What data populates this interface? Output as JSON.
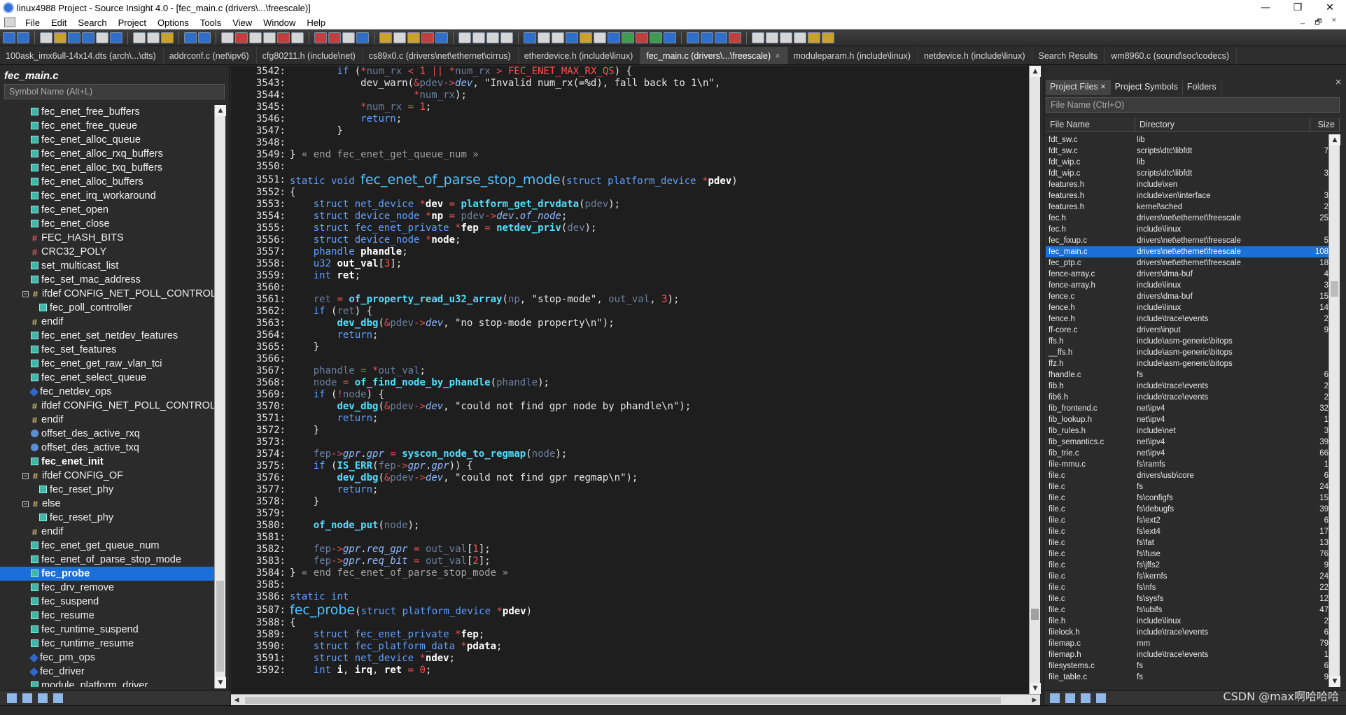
{
  "window": {
    "title": "linux4988 Project - Source Insight 4.0 - [fec_main.c (drivers\\...\\freescale)]",
    "controls": [
      "—",
      "❐",
      "✕"
    ]
  },
  "menu": {
    "items": [
      "File",
      "Edit",
      "Search",
      "Project",
      "Options",
      "Tools",
      "View",
      "Window",
      "Help"
    ],
    "right_controls": [
      "_",
      "🗗",
      "×"
    ]
  },
  "tabs": [
    {
      "label": "100ask_imx6ull-14x14.dts (arch\\...\\dts)",
      "active": false
    },
    {
      "label": "addrconf.c (net\\ipv6)",
      "active": false
    },
    {
      "label": "cfg80211.h (include\\net)",
      "active": false
    },
    {
      "label": "cs89x0.c (drivers\\net\\ethernet\\cirrus)",
      "active": false
    },
    {
      "label": "etherdevice.h (include\\linux)",
      "active": false
    },
    {
      "label": "fec_main.c (drivers\\...\\freescale)",
      "active": true,
      "close": "×"
    },
    {
      "label": "moduleparam.h (include\\linux)",
      "active": false
    },
    {
      "label": "netdevice.h (include\\linux)",
      "active": false
    },
    {
      "label": "Search Results",
      "active": false
    },
    {
      "label": "wm8960.c (sound\\soc\\codecs)",
      "active": false
    }
  ],
  "symbol_panel": {
    "title": "fec_main.c",
    "search_placeholder": "Symbol Name (Alt+L)",
    "symbols": [
      {
        "label": "fec_enet_free_buffers",
        "icon": "func",
        "indent": 1
      },
      {
        "label": "fec_enet_free_queue",
        "icon": "func",
        "indent": 1
      },
      {
        "label": "fec_enet_alloc_queue",
        "icon": "func",
        "indent": 1
      },
      {
        "label": "fec_enet_alloc_rxq_buffers",
        "icon": "func",
        "indent": 1
      },
      {
        "label": "fec_enet_alloc_txq_buffers",
        "icon": "func",
        "indent": 1
      },
      {
        "label": "fec_enet_alloc_buffers",
        "icon": "func",
        "indent": 1
      },
      {
        "label": "fec_enet_irq_workaround",
        "icon": "func",
        "indent": 1
      },
      {
        "label": "fec_enet_open",
        "icon": "func",
        "indent": 1
      },
      {
        "label": "fec_enet_close",
        "icon": "func",
        "indent": 1
      },
      {
        "label": "FEC_HASH_BITS",
        "icon": "def",
        "indent": 1
      },
      {
        "label": "CRC32_POLY",
        "icon": "def",
        "indent": 1
      },
      {
        "label": "set_multicast_list",
        "icon": "func",
        "indent": 1
      },
      {
        "label": "fec_set_mac_address",
        "icon": "func",
        "indent": 1
      },
      {
        "label": "ifdef CONFIG_NET_POLL_CONTROLL",
        "icon": "if",
        "indent": 0,
        "tree": "−"
      },
      {
        "label": "fec_poll_controller",
        "icon": "func",
        "indent": 2
      },
      {
        "label": "endif",
        "icon": "if",
        "indent": 1
      },
      {
        "label": "fec_enet_set_netdev_features",
        "icon": "func",
        "indent": 1
      },
      {
        "label": "fec_set_features",
        "icon": "func",
        "indent": 1
      },
      {
        "label": "fec_enet_get_raw_vlan_tci",
        "icon": "func",
        "indent": 1
      },
      {
        "label": "fec_enet_select_queue",
        "icon": "func",
        "indent": 1
      },
      {
        "label": "fec_netdev_ops",
        "icon": "struct",
        "indent": 1
      },
      {
        "label": "ifdef CONFIG_NET_POLL_CONTROLL",
        "icon": "if",
        "indent": 1
      },
      {
        "label": "endif",
        "icon": "if",
        "indent": 1
      },
      {
        "label": "offset_des_active_rxq",
        "icon": "var",
        "indent": 1
      },
      {
        "label": "offset_des_active_txq",
        "icon": "var",
        "indent": 1
      },
      {
        "label": "fec_enet_init",
        "icon": "func",
        "indent": 1,
        "bold": true
      },
      {
        "label": "ifdef CONFIG_OF",
        "icon": "if",
        "indent": 0,
        "tree": "−"
      },
      {
        "label": "fec_reset_phy",
        "icon": "func",
        "indent": 2
      },
      {
        "label": "else",
        "icon": "if",
        "indent": 0,
        "tree": "−"
      },
      {
        "label": "fec_reset_phy",
        "icon": "func",
        "indent": 2
      },
      {
        "label": "endif",
        "icon": "if",
        "indent": 1
      },
      {
        "label": "fec_enet_get_queue_num",
        "icon": "func",
        "indent": 1
      },
      {
        "label": "fec_enet_of_parse_stop_mode",
        "icon": "func",
        "indent": 1
      },
      {
        "label": "fec_probe",
        "icon": "func",
        "indent": 1,
        "selected": true
      },
      {
        "label": "fec_drv_remove",
        "icon": "func",
        "indent": 1
      },
      {
        "label": "fec_suspend",
        "icon": "func",
        "indent": 1
      },
      {
        "label": "fec_resume",
        "icon": "func",
        "indent": 1
      },
      {
        "label": "fec_runtime_suspend",
        "icon": "func",
        "indent": 1
      },
      {
        "label": "fec_runtime_resume",
        "icon": "func",
        "indent": 1
      },
      {
        "label": "fec_pm_ops",
        "icon": "struct",
        "indent": 1
      },
      {
        "label": "fec_driver",
        "icon": "struct",
        "indent": 1
      },
      {
        "label": "module_platform_driver",
        "icon": "func",
        "indent": 1
      }
    ]
  },
  "code_lines": [
    {
      "n": "3542:",
      "h": "        <span class=\"kw\">if</span> (<span class=\"op\">*</span><span class=\"par\">num_rx</span> <span class=\"op\">&lt;</span> <span class=\"num2\">1</span> <span class=\"op\">||</span> <span class=\"op\">*</span><span class=\"par\">num_rx</span> <span class=\"op\">&gt;</span> <span class=\"mac\">FEC_ENET_MAX_RX_QS</span>) {"
    },
    {
      "n": "3543:",
      "h": "            dev_warn(<span class=\"op\">&amp;</span><span class=\"par\">pdev</span><span class=\"op\">-&gt;</span><span class=\"it\">dev</span>, \"Invalid num_rx(=%d), fall back to 1\\n\","
    },
    {
      "n": "3544:",
      "h": "                     <span class=\"op\">*</span><span class=\"par\">num_rx</span>);"
    },
    {
      "n": "3545:",
      "h": "            <span class=\"op\">*</span><span class=\"par\">num_rx</span> <span class=\"op\">=</span> <span class=\"num2\">1</span>;"
    },
    {
      "n": "3546:",
      "h": "            <span class=\"kw\">return</span>;"
    },
    {
      "n": "3547:",
      "h": "        }"
    },
    {
      "n": "3548:",
      "h": ""
    },
    {
      "n": "3549:",
      "h": "<span class=\"brk\">}</span> <span class=\"cm\">« end fec_enet_get_queue_num »</span>"
    },
    {
      "n": "3550:",
      "h": ""
    },
    {
      "n": "3551:",
      "big": true,
      "h": "<span class=\"kw\">static</span> <span class=\"kw\">void</span> <span class=\"fnbig\">fec_enet_of_parse_stop_mode</span>(<span class=\"ty\">struct</span> <span class=\"ty\">platform_device</span> <span class=\"op\">*</span><span class=\"bold\">pdev</span>)"
    },
    {
      "n": "3552:",
      "h": "{"
    },
    {
      "n": "3553:",
      "h": "    <span class=\"ty\">struct net_device</span> <span class=\"op\">*</span><span class=\"bold\">dev</span> <span class=\"op\">=</span> <span class=\"fn\">platform_get_drvdata</span>(<span class=\"par\">pdev</span>);"
    },
    {
      "n": "3554:",
      "h": "    <span class=\"ty\">struct device_node</span> <span class=\"op\">*</span><span class=\"bold\">np</span> <span class=\"op\">=</span> <span class=\"par\">pdev</span><span class=\"op\">-&gt;</span><span class=\"it\">dev</span>.<span class=\"it\">of_node</span>;"
    },
    {
      "n": "3555:",
      "h": "    <span class=\"ty\">struct fec_enet_private</span> <span class=\"op\">*</span><span class=\"bold\">fep</span> <span class=\"op\">=</span> <span class=\"fn\">netdev_priv</span>(<span class=\"par\">dev</span>);"
    },
    {
      "n": "3556:",
      "h": "    <span class=\"ty\">struct device_node</span> <span class=\"op\">*</span><span class=\"bold\">node</span>;"
    },
    {
      "n": "3557:",
      "h": "    <span class=\"ty\">phandle</span> <span class=\"bold\">phandle</span>;"
    },
    {
      "n": "3558:",
      "h": "    <span class=\"ty\">u32</span> <span class=\"bold\">out_val</span>[<span class=\"num2\">3</span>];"
    },
    {
      "n": "3559:",
      "h": "    <span class=\"kw\">int</span> <span class=\"bold\">ret</span>;"
    },
    {
      "n": "3560:",
      "h": ""
    },
    {
      "n": "3561:",
      "h": "    <span class=\"par\">ret</span> <span class=\"op\">=</span> <span class=\"fn\">of_property_read_u32_array</span>(<span class=\"par\">np</span>, \"stop-mode\", <span class=\"par\">out_val</span>, <span class=\"num2\">3</span>);"
    },
    {
      "n": "3562:",
      "h": "    <span class=\"kw\">if</span> (<span class=\"par\">ret</span>) {"
    },
    {
      "n": "3563:",
      "h": "        <span class=\"fn\">dev_dbg</span>(<span class=\"op\">&amp;</span><span class=\"par\">pdev</span><span class=\"op\">-&gt;</span><span class=\"it\">dev</span>, \"no stop-mode property\\n\");"
    },
    {
      "n": "3564:",
      "h": "        <span class=\"kw\">return</span>;"
    },
    {
      "n": "3565:",
      "h": "    }"
    },
    {
      "n": "3566:",
      "h": ""
    },
    {
      "n": "3567:",
      "h": "    <span class=\"par\">phandle</span> <span class=\"op\">=</span> <span class=\"op\">*</span><span class=\"par\">out_val</span>;"
    },
    {
      "n": "3568:",
      "h": "    <span class=\"par\">node</span> <span class=\"op\">=</span> <span class=\"fn\">of_find_node_by_phandle</span>(<span class=\"par\">phandle</span>);"
    },
    {
      "n": "3569:",
      "h": "    <span class=\"kw\">if</span> (<span class=\"op\">!</span><span class=\"par\">node</span>) {"
    },
    {
      "n": "3570:",
      "h": "        <span class=\"fn\">dev_dbg</span>(<span class=\"op\">&amp;</span><span class=\"par\">pdev</span><span class=\"op\">-&gt;</span><span class=\"it\">dev</span>, \"could not find gpr node by phandle\\n\");"
    },
    {
      "n": "3571:",
      "h": "        <span class=\"kw\">return</span>;"
    },
    {
      "n": "3572:",
      "h": "    }"
    },
    {
      "n": "3573:",
      "h": ""
    },
    {
      "n": "3574:",
      "h": "    <span class=\"par\">fep</span><span class=\"op\">-&gt;</span><span class=\"it\">gpr</span>.<span class=\"it\">gpr</span> <span class=\"op\">=</span> <span class=\"fn\">syscon_node_to_regmap</span>(<span class=\"par\">node</span>);"
    },
    {
      "n": "3575:",
      "h": "    <span class=\"kw\">if</span> (<span class=\"fn\">IS_ERR</span>(<span class=\"par\">fep</span><span class=\"op\">-&gt;</span><span class=\"it\">gpr</span>.<span class=\"it\">gpr</span>)) {"
    },
    {
      "n": "3576:",
      "h": "        <span class=\"fn\">dev_dbg</span>(<span class=\"op\">&amp;</span><span class=\"par\">pdev</span><span class=\"op\">-&gt;</span><span class=\"it\">dev</span>, \"could not find gpr regmap\\n\");"
    },
    {
      "n": "3577:",
      "h": "        <span class=\"kw\">return</span>;"
    },
    {
      "n": "3578:",
      "h": "    }"
    },
    {
      "n": "3579:",
      "h": ""
    },
    {
      "n": "3580:",
      "h": "    <span class=\"fn\">of_node_put</span>(<span class=\"par\">node</span>);"
    },
    {
      "n": "3581:",
      "h": ""
    },
    {
      "n": "3582:",
      "h": "    <span class=\"par\">fep</span><span class=\"op\">-&gt;</span><span class=\"it\">gpr</span>.<span class=\"it\">req_gpr</span> <span class=\"op\">=</span> <span class=\"par\">out_val</span>[<span class=\"num2\">1</span>];"
    },
    {
      "n": "3583:",
      "h": "    <span class=\"par\">fep</span><span class=\"op\">-&gt;</span><span class=\"it\">gpr</span>.<span class=\"it\">req_bit</span> <span class=\"op\">=</span> <span class=\"par\">out_val</span>[<span class=\"num2\">2</span>];"
    },
    {
      "n": "3584:",
      "h": "<span class=\"brk\">}</span> <span class=\"cm\">« end fec_enet_of_parse_stop_mode »</span>"
    },
    {
      "n": "3585:",
      "h": ""
    },
    {
      "n": "3586:",
      "h": "<span class=\"kw\">static</span> <span class=\"kw\">int</span>"
    },
    {
      "n": "3587:",
      "big": true,
      "h": "<span class=\"fnbig\">fec_probe</span>(<span class=\"ty\">struct</span> <span class=\"ty\">platform_device</span> <span class=\"op\">*</span><span class=\"bold\">pdev</span>)"
    },
    {
      "n": "3588:",
      "h": "{"
    },
    {
      "n": "3589:",
      "h": "    <span class=\"ty\">struct fec_enet_private</span> <span class=\"op\">*</span><span class=\"bold\">fep</span>;"
    },
    {
      "n": "3590:",
      "h": "    <span class=\"ty\">struct fec_platform_data</span> <span class=\"op\">*</span><span class=\"bold\">pdata</span>;"
    },
    {
      "n": "3591:",
      "h": "    <span class=\"ty\">struct net_device</span> <span class=\"op\">*</span><span class=\"bold\">ndev</span>;"
    },
    {
      "n": "3592:",
      "h": "    <span class=\"kw\">int</span> <span class=\"bold\">i</span>, <span class=\"bold\">irq</span>, <span class=\"bold\">ret</span> <span class=\"op\">=</span> <span class=\"num2\">0</span>;"
    }
  ],
  "project_panel": {
    "tabs": [
      "Project Files",
      "Project Symbols",
      "Folders"
    ],
    "tab_close": "×",
    "close": "× ",
    "search_placeholder": "File Name (Ctrl+O)",
    "columns": [
      "File Name",
      "Directory",
      "Size"
    ],
    "files": [
      [
        "fdt_sw.c",
        "lib",
        ""
      ],
      [
        "fdt_sw.c",
        "scripts\\dtc\\libfdt",
        "7"
      ],
      [
        "fdt_wip.c",
        "lib",
        ""
      ],
      [
        "fdt_wip.c",
        "scripts\\dtc\\libfdt",
        "3"
      ],
      [
        "features.h",
        "include\\xen",
        ""
      ],
      [
        "features.h",
        "include\\xen\\interface",
        "3"
      ],
      [
        "features.h",
        "kernel\\sched",
        "2"
      ],
      [
        "fec.h",
        "drivers\\net\\ethernet\\freescale",
        "25"
      ],
      [
        "fec.h",
        "include\\linux",
        ""
      ],
      [
        "fec_fixup.c",
        "drivers\\net\\ethernet\\freescale",
        "5"
      ],
      [
        "fec_main.c",
        "drivers\\net\\ethernet\\freescale",
        "108"
      ],
      [
        "fec_ptp.c",
        "drivers\\net\\ethernet\\freescale",
        "18"
      ],
      [
        "fence-array.c",
        "drivers\\dma-buf",
        "4"
      ],
      [
        "fence-array.h",
        "include\\linux",
        "3"
      ],
      [
        "fence.c",
        "drivers\\dma-buf",
        "15"
      ],
      [
        "fence.h",
        "include\\linux",
        "14"
      ],
      [
        "fence.h",
        "include\\trace\\events",
        "2"
      ],
      [
        "ff-core.c",
        "drivers\\input",
        "9"
      ],
      [
        "ffs.h",
        "include\\asm-generic\\bitops",
        ""
      ],
      [
        "__ffs.h",
        "include\\asm-generic\\bitops",
        ""
      ],
      [
        "ffz.h",
        "include\\asm-generic\\bitops",
        ""
      ],
      [
        "fhandle.c",
        "fs",
        "6"
      ],
      [
        "fib.h",
        "include\\trace\\events",
        "2"
      ],
      [
        "fib6.h",
        "include\\trace\\events",
        "2"
      ],
      [
        "fib_frontend.c",
        "net\\ipv4",
        "32"
      ],
      [
        "fib_lookup.h",
        "net\\ipv4",
        "1"
      ],
      [
        "fib_rules.h",
        "include\\net",
        "3"
      ],
      [
        "fib_semantics.c",
        "net\\ipv4",
        "39"
      ],
      [
        "fib_trie.c",
        "net\\ipv4",
        "66"
      ],
      [
        "file-mmu.c",
        "fs\\ramfs",
        "1"
      ],
      [
        "file.c",
        "drivers\\usb\\core",
        "6"
      ],
      [
        "file.c",
        "fs",
        "24"
      ],
      [
        "file.c",
        "fs\\configfs",
        "15"
      ],
      [
        "file.c",
        "fs\\debugfs",
        "39"
      ],
      [
        "file.c",
        "fs\\ext2",
        "6"
      ],
      [
        "file.c",
        "fs\\ext4",
        "17"
      ],
      [
        "file.c",
        "fs\\fat",
        "13"
      ],
      [
        "file.c",
        "fs\\fuse",
        "76"
      ],
      [
        "file.c",
        "fs\\jffs2",
        "9"
      ],
      [
        "file.c",
        "fs\\kernfs",
        "24"
      ],
      [
        "file.c",
        "fs\\nfs",
        "22"
      ],
      [
        "file.c",
        "fs\\sysfs",
        "12"
      ],
      [
        "file.c",
        "fs\\ubifs",
        "47"
      ],
      [
        "file.h",
        "include\\linux",
        "2"
      ],
      [
        "filelock.h",
        "include\\trace\\events",
        "6"
      ],
      [
        "filemap.c",
        "mm",
        "79"
      ],
      [
        "filemap.h",
        "include\\trace\\events",
        "1"
      ],
      [
        "filesystems.c",
        "fs",
        "6"
      ],
      [
        "file_table.c",
        "fs",
        "9"
      ]
    ],
    "selected_index": 10
  },
  "watermark": "CSDN @max啊哈哈哈",
  "colors": {
    "selection": "#1a6fd8",
    "editor_bg": "#1e1e1e",
    "panel_bg": "#2b2b2b"
  }
}
